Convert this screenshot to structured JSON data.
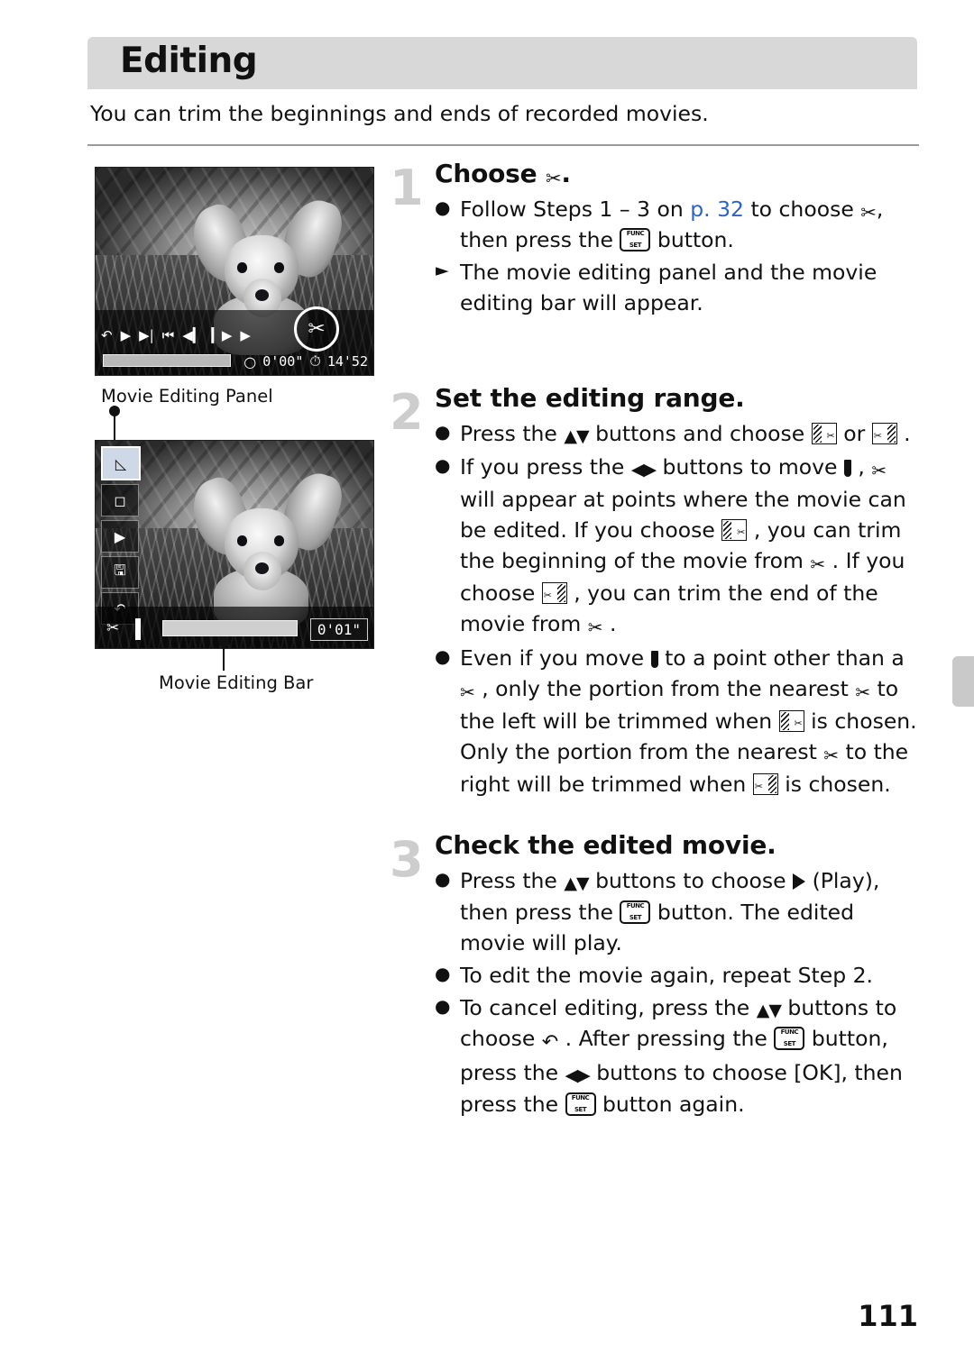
{
  "header": {
    "title": "Editing",
    "intro": "You can trim the beginnings and ends of recorded movies."
  },
  "figures": {
    "fig1": {
      "caption": "Movie Editing Panel",
      "playback_icons": [
        "back-arrow",
        "play",
        "slow-motion",
        "skip-first",
        "frame-back",
        "frame-forward",
        "forward"
      ],
      "elapsed_time": "0'00\"",
      "total_time": "14'52",
      "scissors_icon": "scissors-icon"
    },
    "fig2": {
      "caption": "Movie Editing Bar",
      "panel_items": [
        "trim-start-icon",
        "trim-end-icon",
        "play-icon",
        "save-icon",
        "back-icon"
      ],
      "elapsed_time": "0'01\""
    }
  },
  "steps": [
    {
      "number": "1",
      "heading_before": "Choose",
      "heading_icon": "scissors-icon",
      "heading_after": ".",
      "bullets": [
        {
          "marker": "dot",
          "parts": [
            {
              "t": "text",
              "v": "Follow Steps 1 – 3 on "
            },
            {
              "t": "link",
              "v": "p. 32"
            },
            {
              "t": "text",
              "v": " to choose "
            },
            {
              "t": "icon",
              "v": "scissors-icon"
            },
            {
              "t": "text",
              "v": ", then press the "
            },
            {
              "t": "icon",
              "v": "func-set-button"
            },
            {
              "t": "text",
              "v": " button."
            }
          ]
        },
        {
          "marker": "triangle",
          "parts": [
            {
              "t": "text",
              "v": "The movie editing panel and the movie editing bar will appear."
            }
          ]
        }
      ]
    },
    {
      "number": "2",
      "heading_before": "Set the editing range.",
      "heading_icon": "",
      "heading_after": "",
      "bullets": [
        {
          "marker": "dot",
          "parts": [
            {
              "t": "text",
              "v": "Press the "
            },
            {
              "t": "icon",
              "v": "up-down-buttons"
            },
            {
              "t": "text",
              "v": " buttons and choose "
            },
            {
              "t": "icon",
              "v": "trim-start-icon"
            },
            {
              "t": "text",
              "v": " or "
            },
            {
              "t": "icon",
              "v": "trim-end-icon"
            },
            {
              "t": "text",
              "v": " ."
            }
          ]
        },
        {
          "marker": "dot",
          "parts": [
            {
              "t": "text",
              "v": "If you press the "
            },
            {
              "t": "icon",
              "v": "left-right-buttons"
            },
            {
              "t": "text",
              "v": " buttons to move "
            },
            {
              "t": "icon",
              "v": "marker-icon"
            },
            {
              "t": "text",
              "v": " , "
            },
            {
              "t": "icon",
              "v": "cut-icon"
            },
            {
              "t": "text",
              "v": " will appear at points where the movie can be edited. If you choose "
            },
            {
              "t": "icon",
              "v": "trim-start-icon"
            },
            {
              "t": "text",
              "v": " , you can trim the beginning of the movie from "
            },
            {
              "t": "icon",
              "v": "cut-icon"
            },
            {
              "t": "text",
              "v": " . If you choose "
            },
            {
              "t": "icon",
              "v": "trim-end-icon"
            },
            {
              "t": "text",
              "v": " , you can trim the end of the movie from "
            },
            {
              "t": "icon",
              "v": "cut-icon"
            },
            {
              "t": "text",
              "v": " ."
            }
          ]
        },
        {
          "marker": "dot",
          "parts": [
            {
              "t": "text",
              "v": "Even if you move "
            },
            {
              "t": "icon",
              "v": "marker-icon"
            },
            {
              "t": "text",
              "v": " to a point other than a "
            },
            {
              "t": "icon",
              "v": "cut-icon"
            },
            {
              "t": "text",
              "v": " , only the portion from the nearest "
            },
            {
              "t": "icon",
              "v": "cut-icon"
            },
            {
              "t": "text",
              "v": " to the left will be trimmed when "
            },
            {
              "t": "icon",
              "v": "trim-start-icon"
            },
            {
              "t": "text",
              "v": " is chosen. Only the portion from the nearest "
            },
            {
              "t": "icon",
              "v": "cut-icon"
            },
            {
              "t": "text",
              "v": " to the right will be trimmed when "
            },
            {
              "t": "icon",
              "v": "trim-end-icon"
            },
            {
              "t": "text",
              "v": " is chosen."
            }
          ]
        }
      ]
    },
    {
      "number": "3",
      "heading_before": "Check the edited movie.",
      "heading_icon": "",
      "heading_after": "",
      "bullets": [
        {
          "marker": "dot",
          "parts": [
            {
              "t": "text",
              "v": "Press the "
            },
            {
              "t": "icon",
              "v": "up-down-buttons"
            },
            {
              "t": "text",
              "v": " buttons to choose "
            },
            {
              "t": "icon",
              "v": "play-icon"
            },
            {
              "t": "text",
              "v": " (Play), then press the "
            },
            {
              "t": "icon",
              "v": "func-set-button"
            },
            {
              "t": "text",
              "v": " button. The edited movie will play."
            }
          ]
        },
        {
          "marker": "dot",
          "parts": [
            {
              "t": "text",
              "v": "To edit the movie again, repeat Step 2."
            }
          ]
        },
        {
          "marker": "dot",
          "parts": [
            {
              "t": "text",
              "v": "To cancel editing, press the "
            },
            {
              "t": "icon",
              "v": "up-down-buttons"
            },
            {
              "t": "text",
              "v": " buttons to choose "
            },
            {
              "t": "icon",
              "v": "back-icon"
            },
            {
              "t": "text",
              "v": " . After pressing the "
            },
            {
              "t": "icon",
              "v": "func-set-button"
            },
            {
              "t": "text",
              "v": " button, press the "
            },
            {
              "t": "icon",
              "v": "left-right-buttons"
            },
            {
              "t": "text",
              "v": " buttons to choose [OK], then press the "
            },
            {
              "t": "icon",
              "v": "func-set-button"
            },
            {
              "t": "text",
              "v": " button again."
            }
          ]
        }
      ]
    }
  ],
  "page_number": "111",
  "colors": {
    "title_bar": "#d8d8d8",
    "link": "#2b63c6",
    "step_number": "#cdcdcd"
  }
}
